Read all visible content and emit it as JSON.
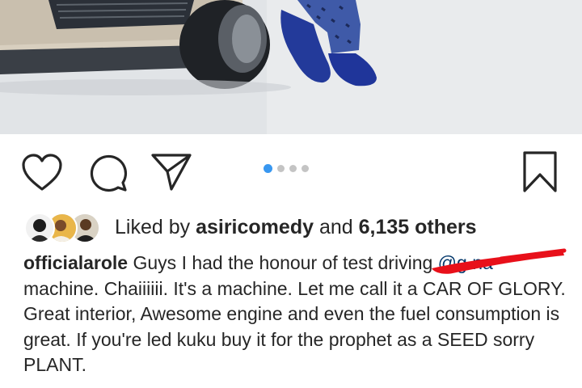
{
  "post": {
    "photo_alt": "",
    "carousel_total": 4,
    "carousel_active_index": 0
  },
  "likes": {
    "prefix": "Liked by",
    "user": "asiricomedy",
    "connector": "and",
    "count": "6,135 others"
  },
  "caption": {
    "username": "officialarole",
    "text_before_mention": "Guys I had the honour of test driving",
    "mention": "@g     na",
    "text_after_mention": "machine. Chaiiiiii. It's a machine. Let me call it a CAR OF GLORY. Great interior, Awesome engine and even the fuel consumption is great. If you're led kuku buy it for the prophet as a SEED sorry PLANT."
  },
  "colors": {
    "accent": "#3897f0",
    "text": "#262626",
    "mention": "#003569",
    "redaction": "#e8101a"
  },
  "icons": [
    "heart-icon",
    "comment-icon",
    "share-icon",
    "bookmark-icon"
  ]
}
